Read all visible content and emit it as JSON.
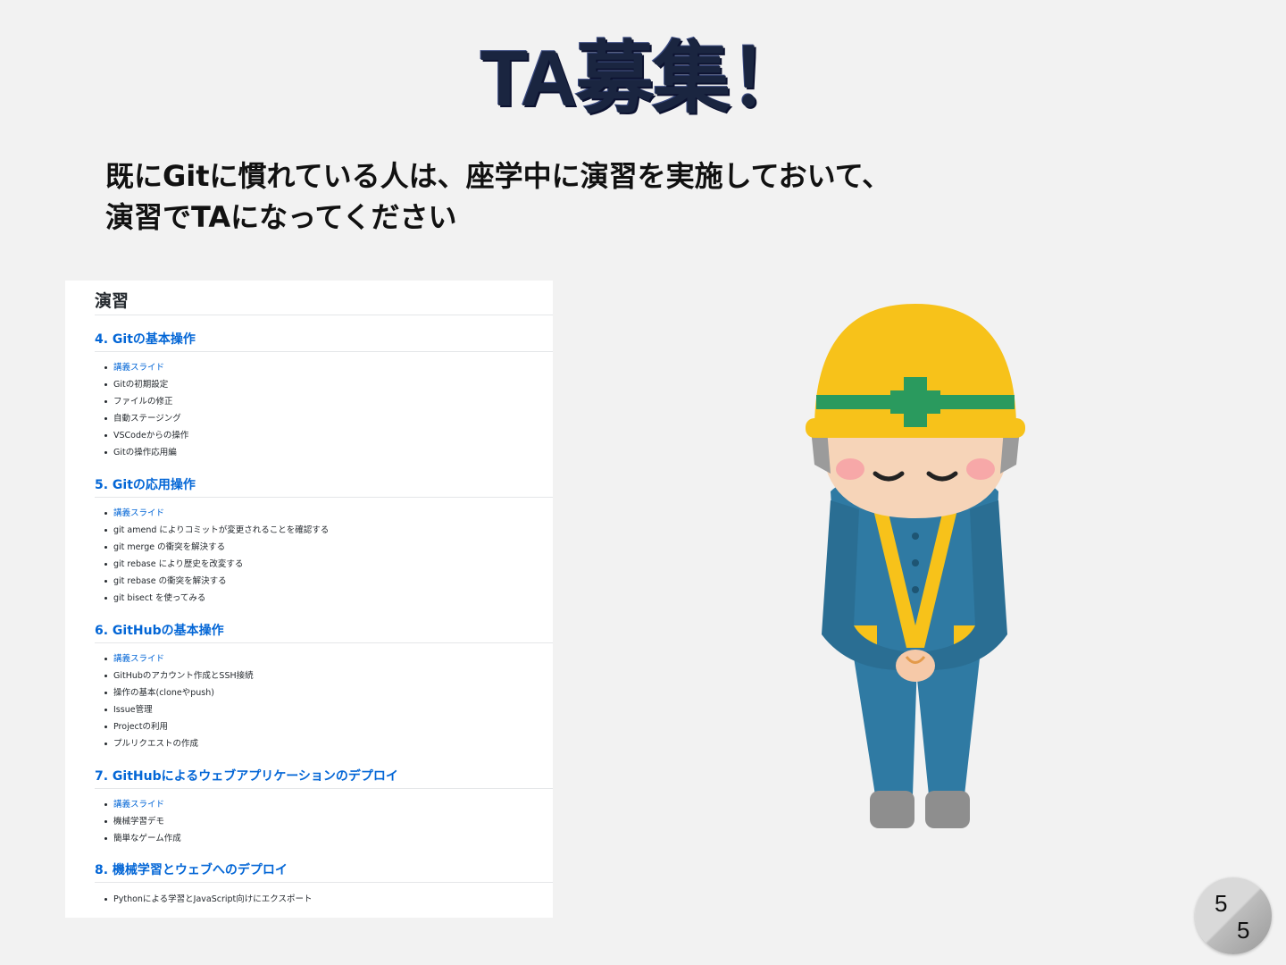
{
  "title": "TA募集！",
  "subtitle": {
    "line1": "既にGitに慣れている人は、座学中に演習を実施しておいて、",
    "line2": "演習でTAになってください"
  },
  "doc": {
    "heading": "演習",
    "sections": [
      {
        "title": "4. Gitの基本操作",
        "items": [
          "講義スライド",
          "Gitの初期設定",
          "ファイルの修正",
          "自動ステージング",
          "VSCodeからの操作",
          "Gitの操作応用編"
        ]
      },
      {
        "title": "5. Gitの応用操作",
        "items": [
          "講義スライド",
          "git amend によりコミットが変更されることを確認する",
          "git merge の衝突を解決する",
          "git rebase により歴史を改変する",
          "git rebase の衝突を解決する",
          "git bisect を使ってみる"
        ]
      },
      {
        "title": "6. GitHubの基本操作",
        "items": [
          "講義スライド",
          "GitHubのアカウント作成とSSH接続",
          "操作の基本(cloneやpush)",
          "Issue管理",
          "Projectの利用",
          "プルリクエストの作成"
        ]
      },
      {
        "title": "7. GitHubによるウェブアプリケーションのデプロイ",
        "items": [
          "講義スライド",
          "機械学習デモ",
          "簡単なゲーム作成"
        ]
      },
      {
        "title": "8. 機械学習とウェブへのデプロイ",
        "items": [
          "Pythonによる学習とJavaScript向けにエクスポート"
        ]
      }
    ]
  },
  "page_badge": {
    "top": "5",
    "bottom": "5"
  },
  "illustration": {
    "icon": "bowing-construction-worker-icon"
  },
  "colors": {
    "background": "#f2f2f2",
    "title": "#1a2540",
    "link": "#0366d6",
    "helmet": "#f7c21a",
    "uniform": "#2f7aa3",
    "stripe": "#2a9a5e"
  }
}
